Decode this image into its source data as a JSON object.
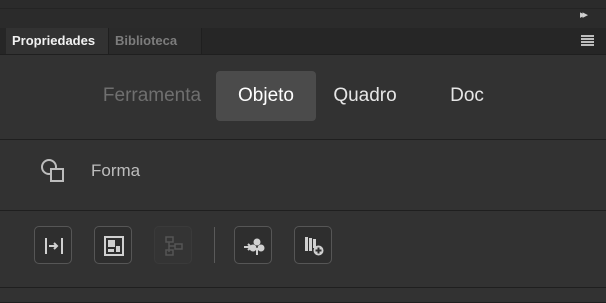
{
  "panel": {
    "tabs": [
      {
        "label": "Propriedades",
        "active": true
      },
      {
        "label": "Biblioteca",
        "active": false
      }
    ],
    "context_tabs": [
      {
        "label": "Ferramenta",
        "state": "dimmed"
      },
      {
        "label": "Objeto",
        "state": "selected"
      },
      {
        "label": "Quadro",
        "state": "normal"
      },
      {
        "label": "Doc",
        "state": "normal"
      }
    ],
    "object_type": {
      "label": "Forma",
      "icon": "shape-icon"
    },
    "tools": [
      {
        "name": "align-icon",
        "enabled": true
      },
      {
        "name": "properties-icon",
        "enabled": true
      },
      {
        "name": "hierarchy-icon",
        "enabled": false
      },
      {
        "name": "convert-to-symbol-icon",
        "enabled": true
      },
      {
        "name": "add-to-library-icon",
        "enabled": true
      }
    ]
  }
}
